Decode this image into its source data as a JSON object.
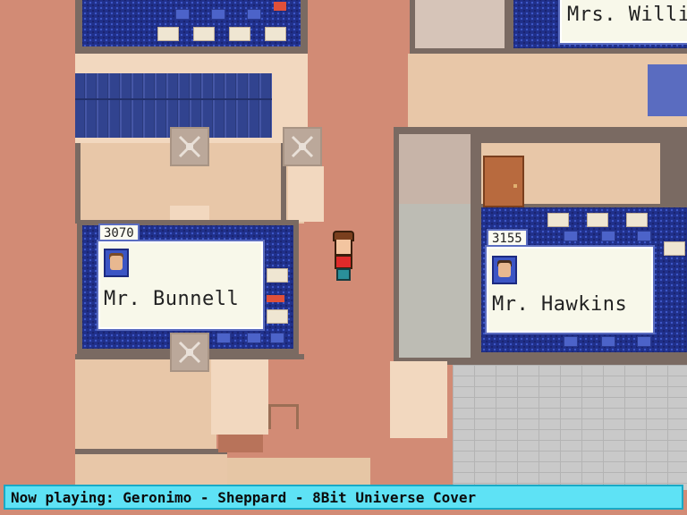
{
  "classrooms": [
    {
      "room": "3070",
      "teacher": "Mr. Bunnell"
    },
    {
      "room": "3155",
      "teacher": "Mr. Hawkins"
    },
    {
      "room": "",
      "teacher": "Mrs. Willia"
    }
  ],
  "player": {
    "shirt_color": "#e02a2a",
    "pants_color": "#2a8f9a",
    "hair_color": "#7a3f1e"
  },
  "now_playing": "Now playing: Geronimo - Sheppard - 8Bit Universe Cover",
  "icons": {
    "vent": "x-vent-icon",
    "avatar": "teacher-portrait-icon",
    "door": "door-icon"
  },
  "colors": {
    "hallway": "#d28b75",
    "carpet": "#20308a",
    "label_border": "#5a6cc0",
    "status_bar": "#5ee2f5"
  }
}
